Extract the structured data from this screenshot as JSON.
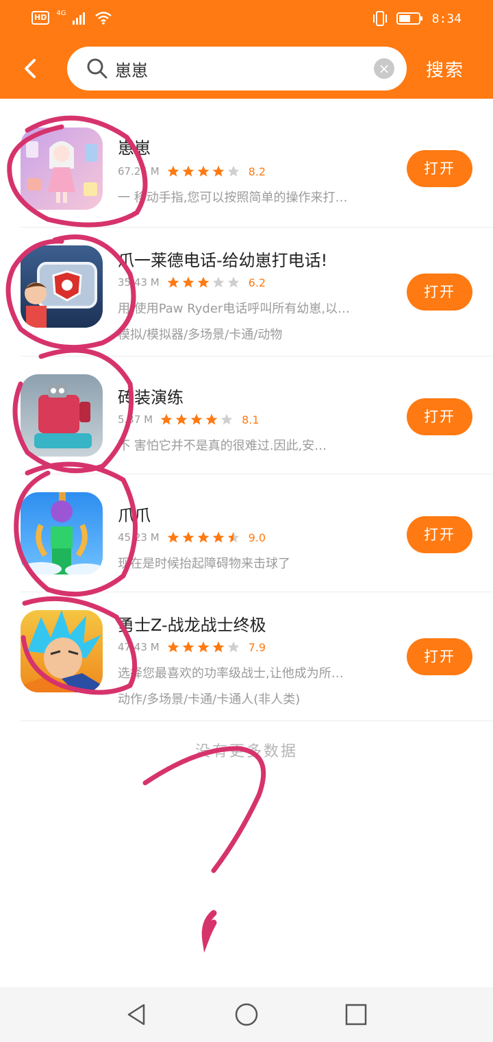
{
  "status_bar": {
    "hd": "HD",
    "network": "4G",
    "time": "8:34"
  },
  "search": {
    "query": "崽崽",
    "button_label": "搜索",
    "clear_symbol": "×"
  },
  "apps": [
    {
      "name": "崽崽",
      "size": "67.26 M",
      "rating": 8.2,
      "stars": 4,
      "desc": "一 移动手指,您可以按照简单的操作来打…",
      "tags": "",
      "open_label": "打开"
    },
    {
      "name": "爪一莱德电话-给幼崽打电话!",
      "size": "35.43 M",
      "rating": 6.2,
      "stars": 3,
      "desc": "用 使用Paw Ryder电话呼叫所有幼崽,以…",
      "tags": "模拟/模拟器/多场景/卡通/动物",
      "open_label": "打开"
    },
    {
      "name": "砖装演练",
      "size": "5.37 M",
      "rating": 8.1,
      "stars": 4,
      "desc": "不 害怕它并不是真的很难过.因此,安…",
      "tags": "",
      "open_label": "打开"
    },
    {
      "name": "爪爪",
      "size": "45.23 M",
      "rating": 9.0,
      "stars": 4.5,
      "desc": "现在是时候抬起障碍物来击球了",
      "tags": "",
      "open_label": "打开"
    },
    {
      "name": "勇士Z-战龙战士终极",
      "size": "47.43 M",
      "rating": 7.9,
      "stars": 4,
      "desc": "选择您最喜欢的功率级战士,让他成为所…",
      "tags": "动作/多场景/卡通/卡通人(非人类)",
      "open_label": "打开"
    }
  ],
  "footer": {
    "no_more": "没有更多数据"
  },
  "colors": {
    "accent": "#ff7a12",
    "annotation": "#d6336c"
  }
}
